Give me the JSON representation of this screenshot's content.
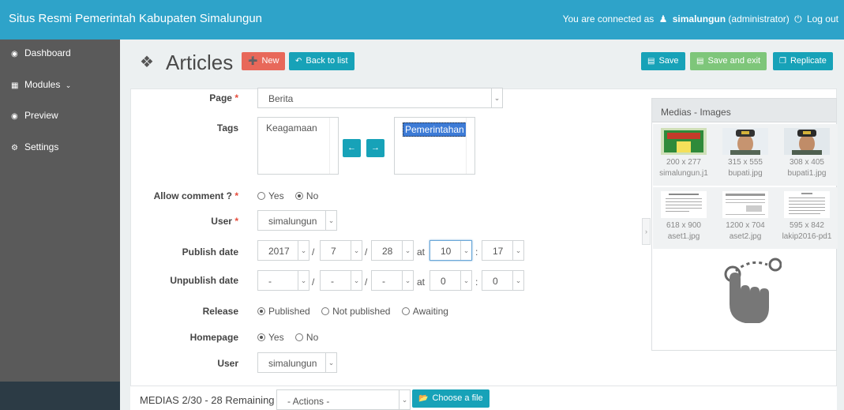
{
  "topbar": {
    "site_title": "Situs Resmi Pemerintah Kabupaten Simalungun",
    "connected_prefix": "You are connected as",
    "username": "simalungun",
    "role": "(administrator)",
    "logout": "Log out"
  },
  "sidebar": {
    "items": [
      {
        "label": "Dashboard",
        "icon": "dashboard-icon"
      },
      {
        "label": "Modules",
        "icon": "grid-icon"
      },
      {
        "label": "Preview",
        "icon": "eye-icon"
      },
      {
        "label": "Settings",
        "icon": "gear-icon"
      }
    ]
  },
  "header": {
    "title": "Articles",
    "new_label": "New",
    "back_label": "Back to list",
    "save_label": "Save",
    "save_exit_label": "Save and exit",
    "replicate_label": "Replicate"
  },
  "form": {
    "page_label": "Page",
    "page_value": "Berita",
    "tags_label": "Tags",
    "tags_available": [
      "Keagamaan"
    ],
    "tags_selected": [
      "Pemerintahan"
    ],
    "allow_comment_label": "Allow comment ?",
    "allow_comment_options": [
      "Yes",
      "No"
    ],
    "allow_comment_value": "No",
    "user_label": "User",
    "user_value": "simalungun",
    "publish_label": "Publish date",
    "publish": {
      "year": "2017",
      "month": "7",
      "day": "28",
      "at": "at",
      "hour": "10",
      "minute": "17"
    },
    "unpublish_label": "Unpublish date",
    "unpublish": {
      "year": "-",
      "month": "-",
      "day": "-",
      "at": "at",
      "hour": "0",
      "minute": "0"
    },
    "release_label": "Release",
    "release_options": [
      "Published",
      "Not published",
      "Awaiting"
    ],
    "release_value": "Published",
    "homepage_label": "Homepage",
    "homepage_options": [
      "Yes",
      "No"
    ],
    "homepage_value": "Yes",
    "user2_label": "User",
    "user2_value": "simalungun"
  },
  "medias_panel": {
    "title": "Medias - Images",
    "items": [
      {
        "dims": "200 x 277",
        "file": "simalungun.j1"
      },
      {
        "dims": "315 x 555",
        "file": "bupati.jpg"
      },
      {
        "dims": "308 x 405",
        "file": "bupati1.jpg"
      },
      {
        "dims": "618 x 900",
        "file": "aset1.jpg"
      },
      {
        "dims": "1200 x 704",
        "file": "aset2.jpg"
      },
      {
        "dims": "595 x 842",
        "file": "lakip2016-pd1"
      }
    ]
  },
  "medias_bar": {
    "label": "MEDIAS 2/30 - 28 Remaining",
    "actions_value": "- Actions -",
    "choose_file": "Choose a file"
  },
  "colors": {
    "topbar": "#2ea3c9",
    "new_button": "#e8685a",
    "info_button": "#17a2b8",
    "save_exit_button": "#7ec67a",
    "sidebar": "#5a5a5a"
  }
}
